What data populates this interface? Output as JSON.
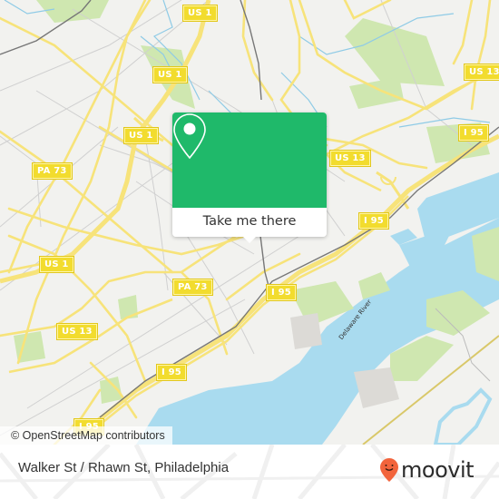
{
  "map": {
    "attribution": "© OpenStreetMap contributors",
    "river_label": "Delaware River",
    "colors": {
      "land": "#f2f2ef",
      "water": "#a9dbef",
      "park": "#cfe7b0",
      "major_road": "#f7e37a",
      "minor_road": "#cfcfcf",
      "rail": "#777777",
      "shield": "#f2dc2e"
    },
    "shields": [
      {
        "label": "US 1"
      },
      {
        "label": "US 1"
      },
      {
        "label": "US 1"
      },
      {
        "label": "US 1"
      },
      {
        "label": "PA 73"
      },
      {
        "label": "PA 73"
      },
      {
        "label": "US 13"
      },
      {
        "label": "US 13"
      },
      {
        "label": "US 13"
      },
      {
        "label": "I 95"
      },
      {
        "label": "I 95"
      },
      {
        "label": "I 95"
      },
      {
        "label": "I 95"
      },
      {
        "label": "I 95"
      }
    ]
  },
  "popup": {
    "icon": "map-pin-icon",
    "button_label": "Take me there",
    "color": "#1fb96a"
  },
  "footer": {
    "stop_name": "Walker St / Rhawn St, Philadelphia",
    "brand": "moovit",
    "brand_color": "#f2643c"
  }
}
